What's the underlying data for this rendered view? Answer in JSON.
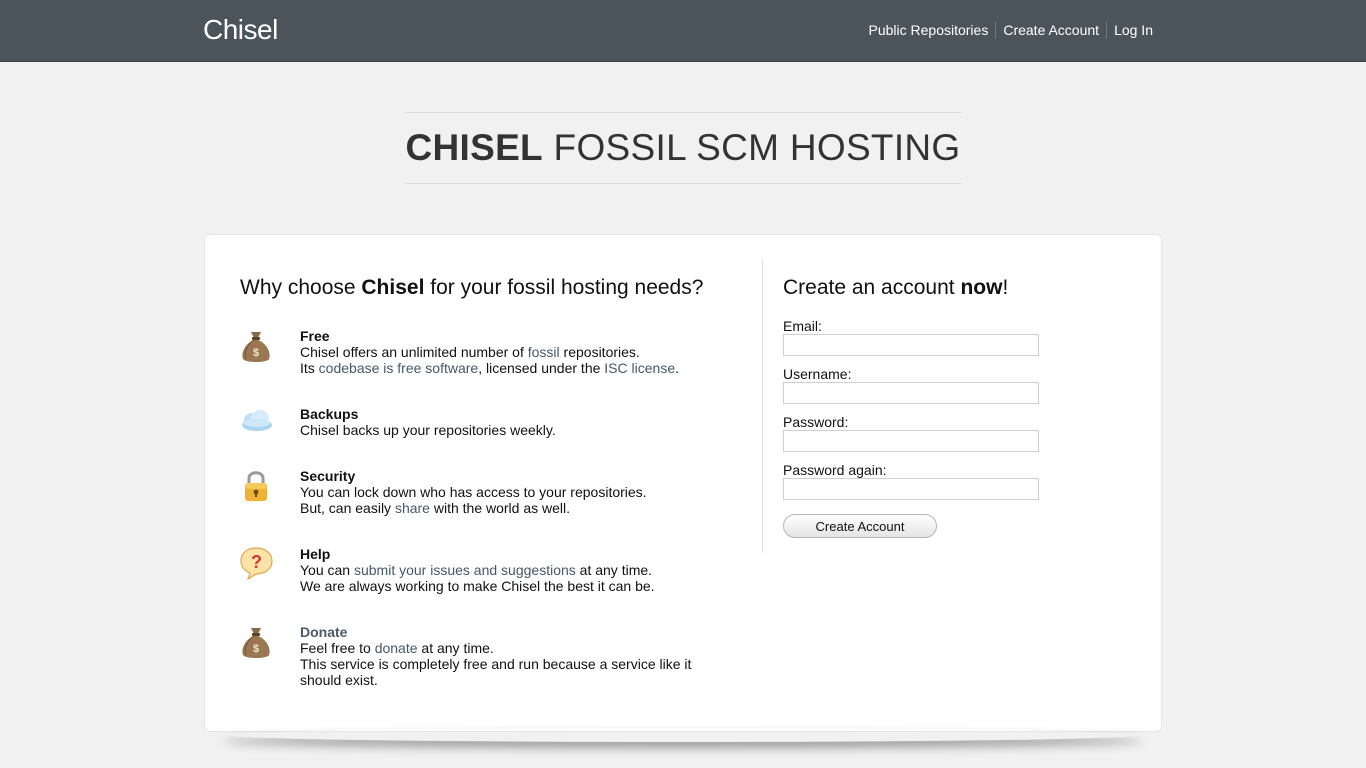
{
  "header": {
    "brand": "Chisel",
    "nav": [
      "Public Repositories",
      "Create Account",
      "Log In"
    ]
  },
  "hero": {
    "strong": "CHISEL",
    "rest": " FOSSIL SCM HOSTING"
  },
  "features_panel": {
    "heading_pre": "Why choose ",
    "heading_strong": "Chisel",
    "heading_post": " for your fossil hosting needs?",
    "free": {
      "title": "Free",
      "line1_pre": "Chisel offers an unlimited number of ",
      "line1_link": "fossil",
      "line1_post": " repositories.",
      "line2_pre": "Its ",
      "line2_link1": "codebase is free software",
      "line2_mid": ", licensed under the ",
      "line2_link2": "ISC license",
      "line2_post": "."
    },
    "backups": {
      "title": "Backups",
      "line1": "Chisel backs up your repositories weekly."
    },
    "security": {
      "title": "Security",
      "line1": "You can lock down who has access to your repositories.",
      "line2_pre": "But, can easily ",
      "line2_link": "share",
      "line2_post": " with the world as well."
    },
    "help": {
      "title": "Help",
      "line1_pre": "You can ",
      "line1_link": "submit your issues and suggestions",
      "line1_post": " at any time.",
      "line2": "We are always working to make Chisel the best it can be."
    },
    "donate": {
      "title": "Donate",
      "line1_pre": "Feel free to ",
      "line1_link": "donate",
      "line1_post": " at any time.",
      "line2": "This service is completely free and run because a service like it should exist."
    }
  },
  "signup": {
    "heading_pre": "Create an account ",
    "heading_strong": "now",
    "heading_post": "!",
    "email_label": "Email:",
    "username_label": "Username:",
    "password_label": "Password:",
    "password_again_label": "Password again:",
    "submit_label": "Create Account"
  },
  "icons": {
    "free": "money-bag-icon",
    "backups": "cloud-icon",
    "security": "padlock-icon",
    "help": "question-bubble-icon",
    "donate": "money-bag-icon"
  },
  "colors": {
    "topbar": "#4b545a",
    "link": "#45586a",
    "background": "#f1f1f1"
  }
}
